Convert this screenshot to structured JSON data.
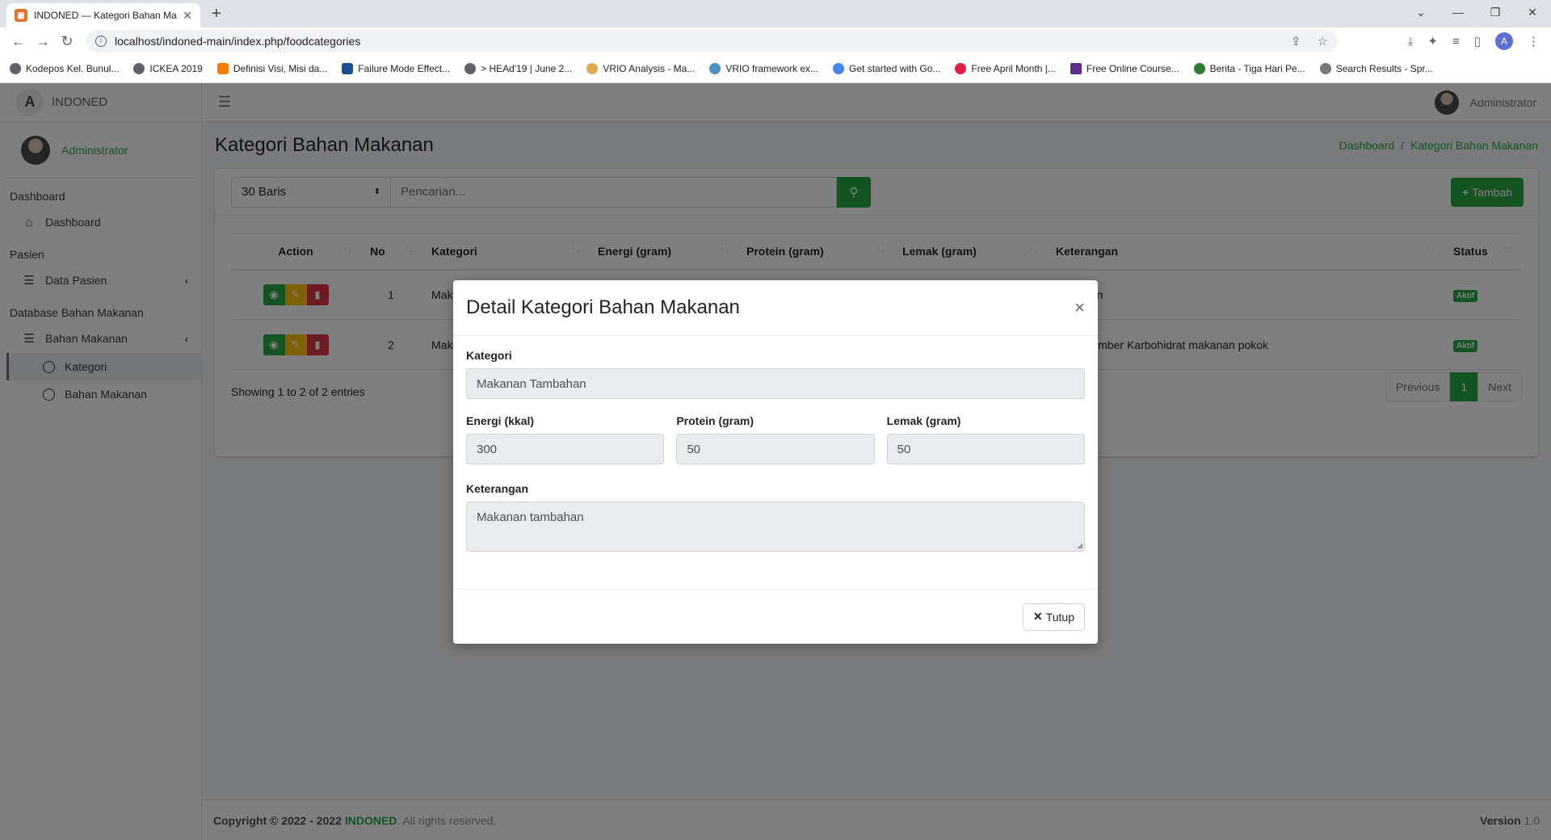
{
  "browser": {
    "tab_title": "INDONED — Kategori Bahan Ma",
    "url": "localhost/indoned-main/index.php/foodcategories",
    "bookmarks": [
      "Kodepos Kel. Bunul...",
      "ICKEA 2019",
      "Definisi Visi, Misi da...",
      "Failure Mode Effect...",
      "> HEAd'19 | June 2...",
      "VRIO Analysis - Ma...",
      "VRIO framework ex...",
      "Get started with Go...",
      "Free April Month |...",
      "Free Online Course...",
      "Berita - Tiga Hari Pe...",
      "Search Results - Spr..."
    ],
    "profile_initial": "A"
  },
  "sidebar": {
    "brand": "INDONED",
    "brand_logo": "A",
    "user": "Administrator",
    "sections": {
      "dashboard_header": "Dashboard",
      "dashboard_item": "Dashboard",
      "pasien_header": "Pasien",
      "pasien_item": "Data Pasien",
      "db_header": "Database Bahan Makanan",
      "db_item": "Bahan Makanan",
      "sub_kategori": "Kategori",
      "sub_bahan": "Bahan Makanan"
    }
  },
  "topnav": {
    "user": "Administrator"
  },
  "page": {
    "title": "Kategori Bahan Makanan",
    "breadcrumb_home": "Dashboard",
    "breadcrumb_current": "Kategori Bahan Makanan",
    "rows_select": "30 Baris",
    "search_placeholder": "Pencarian...",
    "add_label": "Tambah",
    "columns": [
      "Action",
      "No",
      "Kategori",
      "Energi (gram)",
      "Protein (gram)",
      "Lemak (gram)",
      "Keterangan",
      "Status"
    ],
    "rows": [
      {
        "no": "1",
        "kategori": "Makan",
        "keterangan": "ambahan",
        "status": "Aktif"
      },
      {
        "no": "2",
        "kategori": "Makan",
        "keterangan": "anan Sumber Karbohidrat makanan pokok",
        "status": "Aktif"
      }
    ],
    "entries_info": "Showing 1 to 2 of 2 entries",
    "pager": {
      "prev": "Previous",
      "current": "1",
      "next": "Next"
    }
  },
  "footer": {
    "copyright": "Copyright © 2022 - 2022",
    "brand": "INDONED",
    "rights": ". All rights reserved.",
    "version_label": "Version",
    "version": "1.0"
  },
  "modal": {
    "title": "Detail Kategori Bahan Makanan",
    "kategori_label": "Kategori",
    "kategori_value": "Makanan Tambahan",
    "energi_label": "Energi (kkal)",
    "energi_value": "300",
    "protein_label": "Protein (gram)",
    "protein_value": "50",
    "lemak_label": "Lemak (gram)",
    "lemak_value": "50",
    "keterangan_label": "Keterangan",
    "keterangan_value": "Makanan tambahan",
    "close_label": "Tutup"
  },
  "colors": {
    "accent": "#28a745",
    "warning": "#ffc107",
    "danger": "#dc3545"
  }
}
